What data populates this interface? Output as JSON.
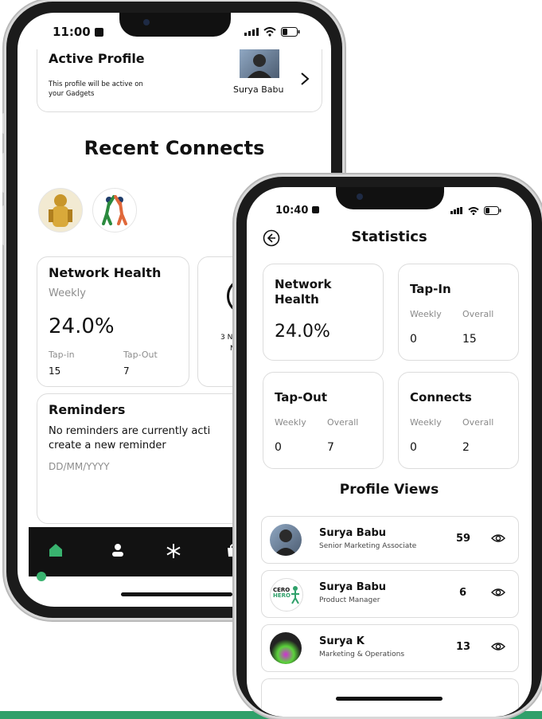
{
  "back_phone": {
    "status_time": "11:00",
    "active_profile": {
      "title": "Active Profile",
      "description_line1": "This profile will be active on",
      "description_line2": "your Gadgets",
      "name": "Surya Babu"
    },
    "recent_connects_title": "Recent Connects",
    "network_health": {
      "title": "Network Health",
      "period": "Weekly",
      "value": "24.0%",
      "tap_in_label": "Tap-in",
      "tap_in_value": "15",
      "tap_out_label": "Tap-Out",
      "tap_out_value": "7"
    },
    "side_card_text_line1": "3 N",
    "side_card_text_line2": "N",
    "reminders": {
      "title": "Reminders",
      "message_line1": "No reminders are currently acti",
      "message_line2": "create a new reminder",
      "date_placeholder": "DD/MM/YYYY"
    },
    "bottom_nav": [
      "home-icon",
      "person-icon",
      "snowflake-icon",
      "bag-icon"
    ]
  },
  "front_phone": {
    "status_time": "10:40",
    "title": "Statistics",
    "network_health": {
      "title_line1": "Network",
      "title_line2": "Health",
      "value": "24.0%"
    },
    "tap_in": {
      "title": "Tap-In",
      "weekly_label": "Weekly",
      "overall_label": "Overall",
      "weekly": "0",
      "overall": "15"
    },
    "tap_out": {
      "title": "Tap-Out",
      "weekly_label": "Weekly",
      "overall_label": "Overall",
      "weekly": "0",
      "overall": "7"
    },
    "connects": {
      "title": "Connects",
      "weekly_label": "Weekly",
      "overall_label": "Overall",
      "weekly": "0",
      "overall": "2"
    },
    "profile_views_title": "Profile Views",
    "profile_views": [
      {
        "name": "Surya Babu",
        "role": "Senior Marketing Associate",
        "count": "59"
      },
      {
        "name": "Surya Babu",
        "role": "Product Manager",
        "count": "6",
        "avatar_text_line1": "CERO",
        "avatar_text_line2": "HERO"
      },
      {
        "name": "Surya K",
        "role": "Marketing & Operations",
        "count": "13"
      }
    ]
  },
  "colors": {
    "accent_green": "#2fa06a",
    "nav_bar": "#121212",
    "card_border": "#dcdcdc"
  }
}
